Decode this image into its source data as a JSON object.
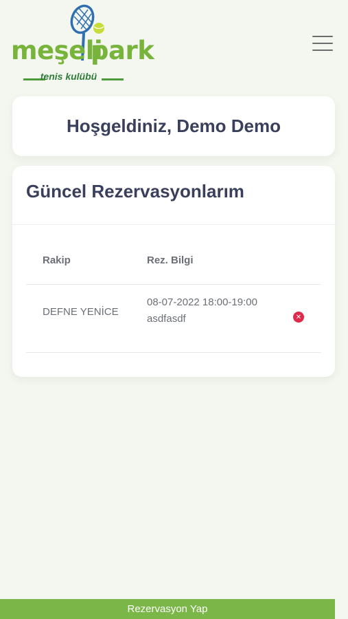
{
  "header": {
    "logo_left": "meşeli",
    "logo_right": "park",
    "logo_sub": "tenis kulübü"
  },
  "welcome": {
    "title": "Hoşgeldiniz, Demo Demo"
  },
  "reservations": {
    "title": "Güncel Rezervasyonlarım",
    "columns": [
      "Rakip",
      "Rez. Bilgi"
    ],
    "rows": [
      {
        "rakip": "DEFNE YENİCE",
        "info": "08-07-2022 18:00-19:00 asdfasdf"
      }
    ]
  },
  "bottom": {
    "button_label": "Rezervasyon Yap"
  },
  "colors": {
    "brand_green": "#78b43c",
    "button_green": "#7ab648",
    "delete_red": "#e0294a"
  },
  "icons": [
    "tennis-racket-icon",
    "hamburger-menu-icon",
    "delete-icon"
  ]
}
